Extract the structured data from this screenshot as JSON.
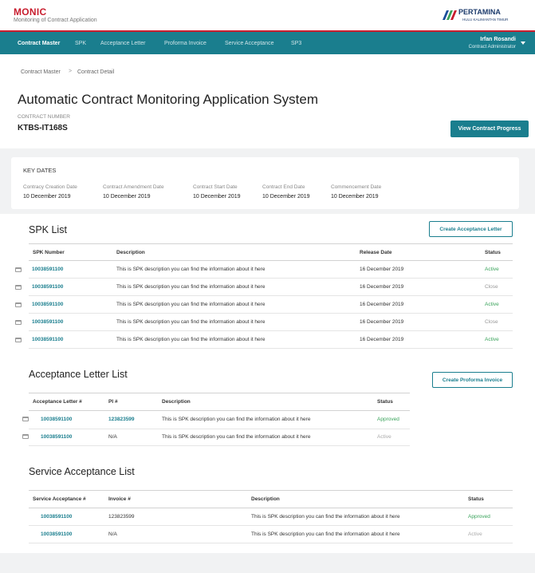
{
  "app": {
    "title": "MONIC",
    "subtitle": "Monitoring of Contract Application",
    "logo_name": "PERTAMINA",
    "logo_sub": "HULU KALIMANTAN TIMUR"
  },
  "nav": {
    "items": [
      "Contract Master",
      "SPK",
      "Acceptance Letter",
      "Proforma Invoice",
      "Service Acceptance",
      "SP3"
    ],
    "user_name": "Irfan Rosandi",
    "user_role": "Contract Administrator"
  },
  "breadcrumb": [
    "Contract Master",
    "Contract Detail"
  ],
  "breadcrumb_sep": ">",
  "page": {
    "title": "Automatic Contract Monitoring Application System",
    "contract_number_label": "CONTRACT NUMBER",
    "contract_number": "KTBS-IT168S",
    "view_progress_label": "View Contract Progress"
  },
  "key_dates": {
    "title": "KEY DATES",
    "items": [
      {
        "label": "Contracy Creation Date",
        "value": "10 December 2019"
      },
      {
        "label": "Contract Amendment Date",
        "value": "10 December 2019"
      },
      {
        "label": "Contract Start Date",
        "value": "10 December 2019"
      },
      {
        "label": "Contract End Date",
        "value": "10 December 2019"
      },
      {
        "label": "Commencement Date",
        "value": "10 December 2019"
      }
    ]
  },
  "spk": {
    "title": "SPK List",
    "button": "Create Acceptance Letter",
    "headers": [
      "SPK Number",
      "Description",
      "Release Date",
      "Status"
    ],
    "rows": [
      {
        "number": "10038591100",
        "desc": "This is SPK description you can find the information about it here",
        "date": "16 December 2019",
        "status": "Active"
      },
      {
        "number": "10038591100",
        "desc": "This is SPK description you can find the information about it here",
        "date": "16 December 2019",
        "status": "Close"
      },
      {
        "number": "10038591100",
        "desc": "This is SPK description you can find the information about it here",
        "date": "16 December 2019",
        "status": "Active"
      },
      {
        "number": "10038591100",
        "desc": "This is SPK description you can find the information about it here",
        "date": "16 December 2019",
        "status": "Close"
      },
      {
        "number": "10038591100",
        "desc": "This is SPK description you can find the information about it here",
        "date": "16 December 2019",
        "status": "Active"
      }
    ]
  },
  "acceptance": {
    "title": "Acceptance Letter  List",
    "button": "Create Proforma Invoice",
    "headers": [
      "Acceptance Letter #",
      "PI #",
      "Description",
      "Status"
    ],
    "rows": [
      {
        "number": "10038591100",
        "pi": "123823599",
        "desc": "This is SPK description you can find the information about it here",
        "status": "Approved"
      },
      {
        "number": "10038591100",
        "pi": "N/A",
        "desc": "This is SPK description you can find the information about it here",
        "status": "Active"
      }
    ]
  },
  "service": {
    "title": "Service Acceptance List",
    "headers": [
      "Service Acceptance #",
      "Invoice  #",
      "Description",
      "Status"
    ],
    "rows": [
      {
        "number": "10038591100",
        "invoice": "123823599",
        "desc": "This is SPK description you can find the information about it here",
        "status": "Approved"
      },
      {
        "number": "10038591100",
        "invoice": "N/A",
        "desc": "This is SPK description you can find the information about it here",
        "status": "Active"
      }
    ]
  },
  "colors": {
    "brand_red": "#c81d2e",
    "teal": "#1a7e8e",
    "status_green": "#3aa35b"
  }
}
